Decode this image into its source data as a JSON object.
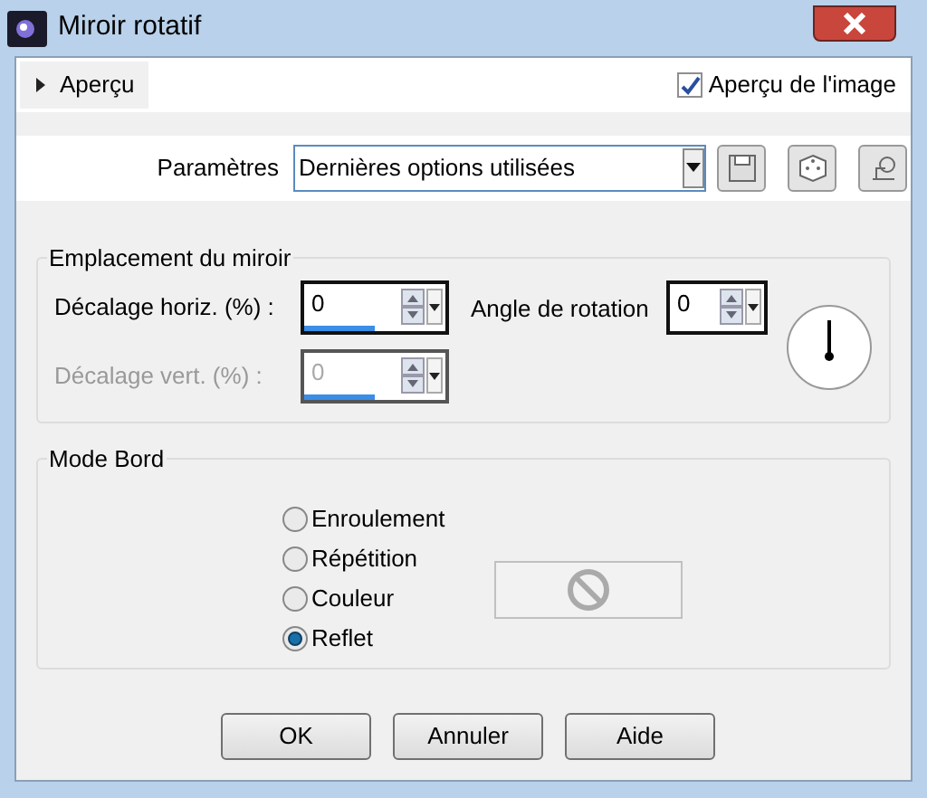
{
  "window": {
    "title": "Miroir rotatif"
  },
  "preview": {
    "label": "Aperçu",
    "expanded": false,
    "image_preview": {
      "label": "Aperçu de l'image",
      "checked": true
    }
  },
  "presets": {
    "label": "Paramètres",
    "value": "Dernières options utilisées"
  },
  "mirror_location": {
    "title": "Emplacement du miroir",
    "fields": [
      {
        "label": "Décalage horiz. (%) :",
        "value": "0",
        "level": 0.5,
        "disabled": false
      },
      {
        "label": "Décalage vert. (%) :",
        "value": "0",
        "level": 0.5,
        "disabled": true
      }
    ],
    "rotation": {
      "label": "Angle de rotation",
      "value": "0"
    }
  },
  "edge_mode": {
    "title": "Mode Bord",
    "options": [
      {
        "label": "Enroulement",
        "selected": false
      },
      {
        "label": "Répétition",
        "selected": false
      },
      {
        "label": "Couleur",
        "selected": false
      },
      {
        "label": "Reflet",
        "selected": true
      }
    ]
  },
  "buttons": [
    "OK",
    "Annuler",
    "Aide"
  ]
}
